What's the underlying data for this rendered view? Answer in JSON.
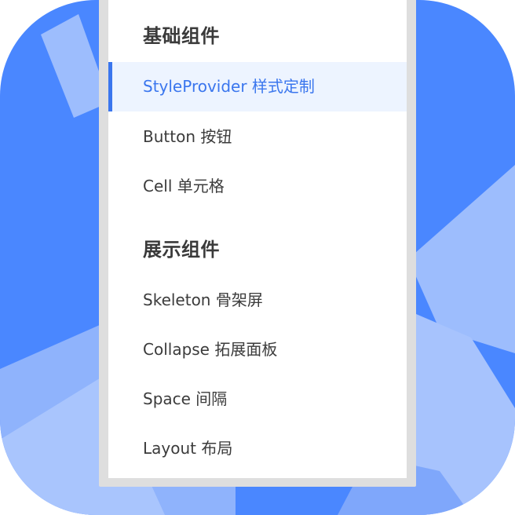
{
  "colors": {
    "background": "#4a87ff",
    "background_light": "#9dbdfd",
    "active_text": "#3a76ee",
    "active_bg": "#edf4ff",
    "text": "#3b3b3b",
    "title": "#3a3a3a"
  },
  "sidebar": {
    "groups": [
      {
        "title": "基础组件",
        "items": [
          {
            "label": "StyleProvider 样式定制",
            "active": true
          },
          {
            "label": "Button 按钮",
            "active": false
          },
          {
            "label": "Cell 单元格",
            "active": false
          }
        ]
      },
      {
        "title": "展示组件",
        "items": [
          {
            "label": "Skeleton 骨架屏",
            "active": false
          },
          {
            "label": "Collapse 拓展面板",
            "active": false
          },
          {
            "label": "Space 间隔",
            "active": false
          },
          {
            "label": "Layout 布局",
            "active": false
          }
        ]
      }
    ]
  }
}
